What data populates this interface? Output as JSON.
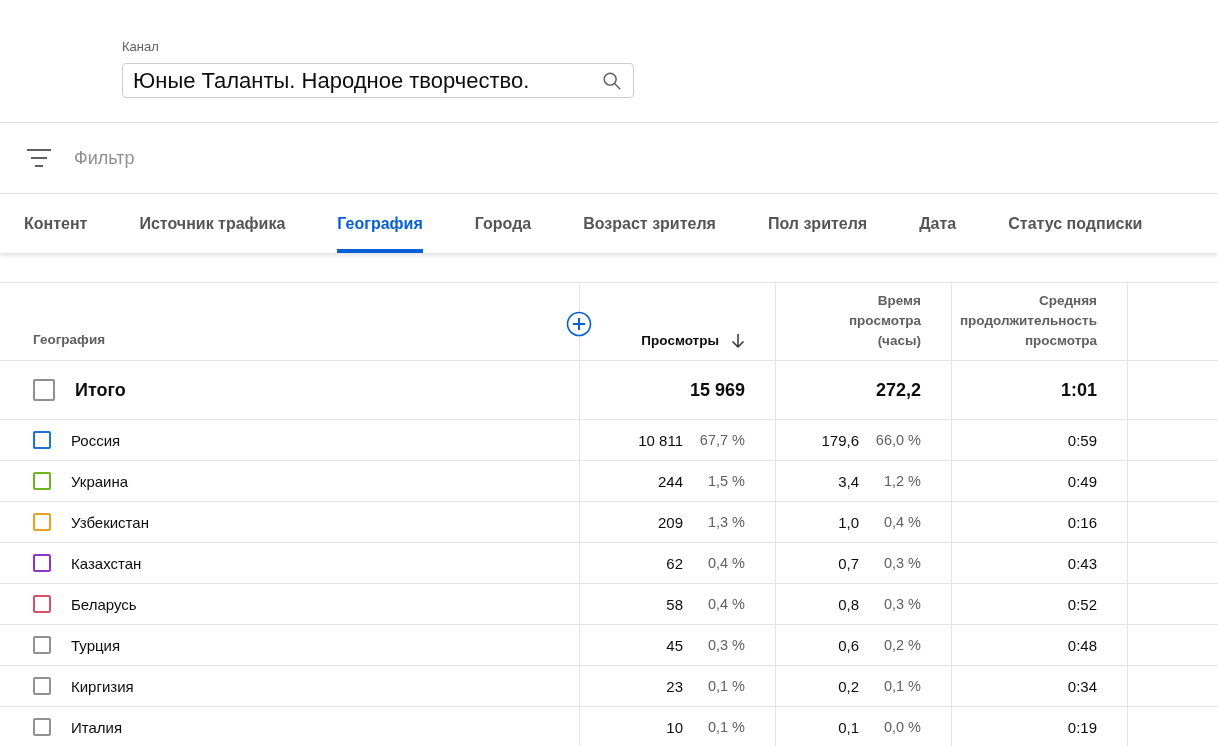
{
  "channel": {
    "label": "Канал",
    "value": "Юные Таланты. Народное творчество."
  },
  "filter": {
    "placeholder": "Фильтр"
  },
  "tabs": [
    {
      "label": "Контент",
      "selected": false
    },
    {
      "label": "Источник трафика",
      "selected": false
    },
    {
      "label": "География",
      "selected": true
    },
    {
      "label": "Города",
      "selected": false
    },
    {
      "label": "Возраст зрителя",
      "selected": false
    },
    {
      "label": "Пол зрителя",
      "selected": false
    },
    {
      "label": "Дата",
      "selected": false
    },
    {
      "label": "Статус подписки",
      "selected": false
    }
  ],
  "table": {
    "columns": [
      {
        "label": "География",
        "sorted": false
      },
      {
        "label": "Просмотры",
        "sorted": true
      },
      {
        "label": "Время просмотра (часы)",
        "sorted": false
      },
      {
        "label": "Средняя продолжительность просмотра",
        "sorted": false
      }
    ],
    "total": {
      "label": "Итого",
      "checked": false,
      "views": "15 969",
      "watch": "272,2",
      "avg": "1:01"
    },
    "rows": [
      {
        "name": "Россия",
        "color": "#1a73d9",
        "checked": false,
        "views": "10 811",
        "views_pct": "67,7 %",
        "watch": "179,6",
        "watch_pct": "66,0 %",
        "avg": "0:59"
      },
      {
        "name": "Украина",
        "color": "#6fb51e",
        "checked": false,
        "views": "244",
        "views_pct": "1,5 %",
        "watch": "3,4",
        "watch_pct": "1,2 %",
        "avg": "0:49"
      },
      {
        "name": "Узбекистан",
        "color": "#e8a020",
        "checked": false,
        "views": "209",
        "views_pct": "1,3 %",
        "watch": "1,0",
        "watch_pct": "0,4 %",
        "avg": "0:16"
      },
      {
        "name": "Казахстан",
        "color": "#9334c9",
        "checked": false,
        "views": "62",
        "views_pct": "0,4 %",
        "watch": "0,7",
        "watch_pct": "0,3 %",
        "avg": "0:43"
      },
      {
        "name": "Беларусь",
        "color": "#d9506c",
        "checked": false,
        "views": "58",
        "views_pct": "0,4 %",
        "watch": "0,8",
        "watch_pct": "0,3 %",
        "avg": "0:52"
      },
      {
        "name": "Турция",
        "color": "#909090",
        "checked": false,
        "views": "45",
        "views_pct": "0,3 %",
        "watch": "0,6",
        "watch_pct": "0,2 %",
        "avg": "0:48"
      },
      {
        "name": "Киргизия",
        "color": "#909090",
        "checked": false,
        "views": "23",
        "views_pct": "0,1 %",
        "watch": "0,2",
        "watch_pct": "0,1 %",
        "avg": "0:34"
      },
      {
        "name": "Италия",
        "color": "#909090",
        "checked": false,
        "views": "10",
        "views_pct": "0,1 %",
        "watch": "0,1",
        "watch_pct": "0,0 %",
        "avg": "0:19"
      }
    ]
  }
}
